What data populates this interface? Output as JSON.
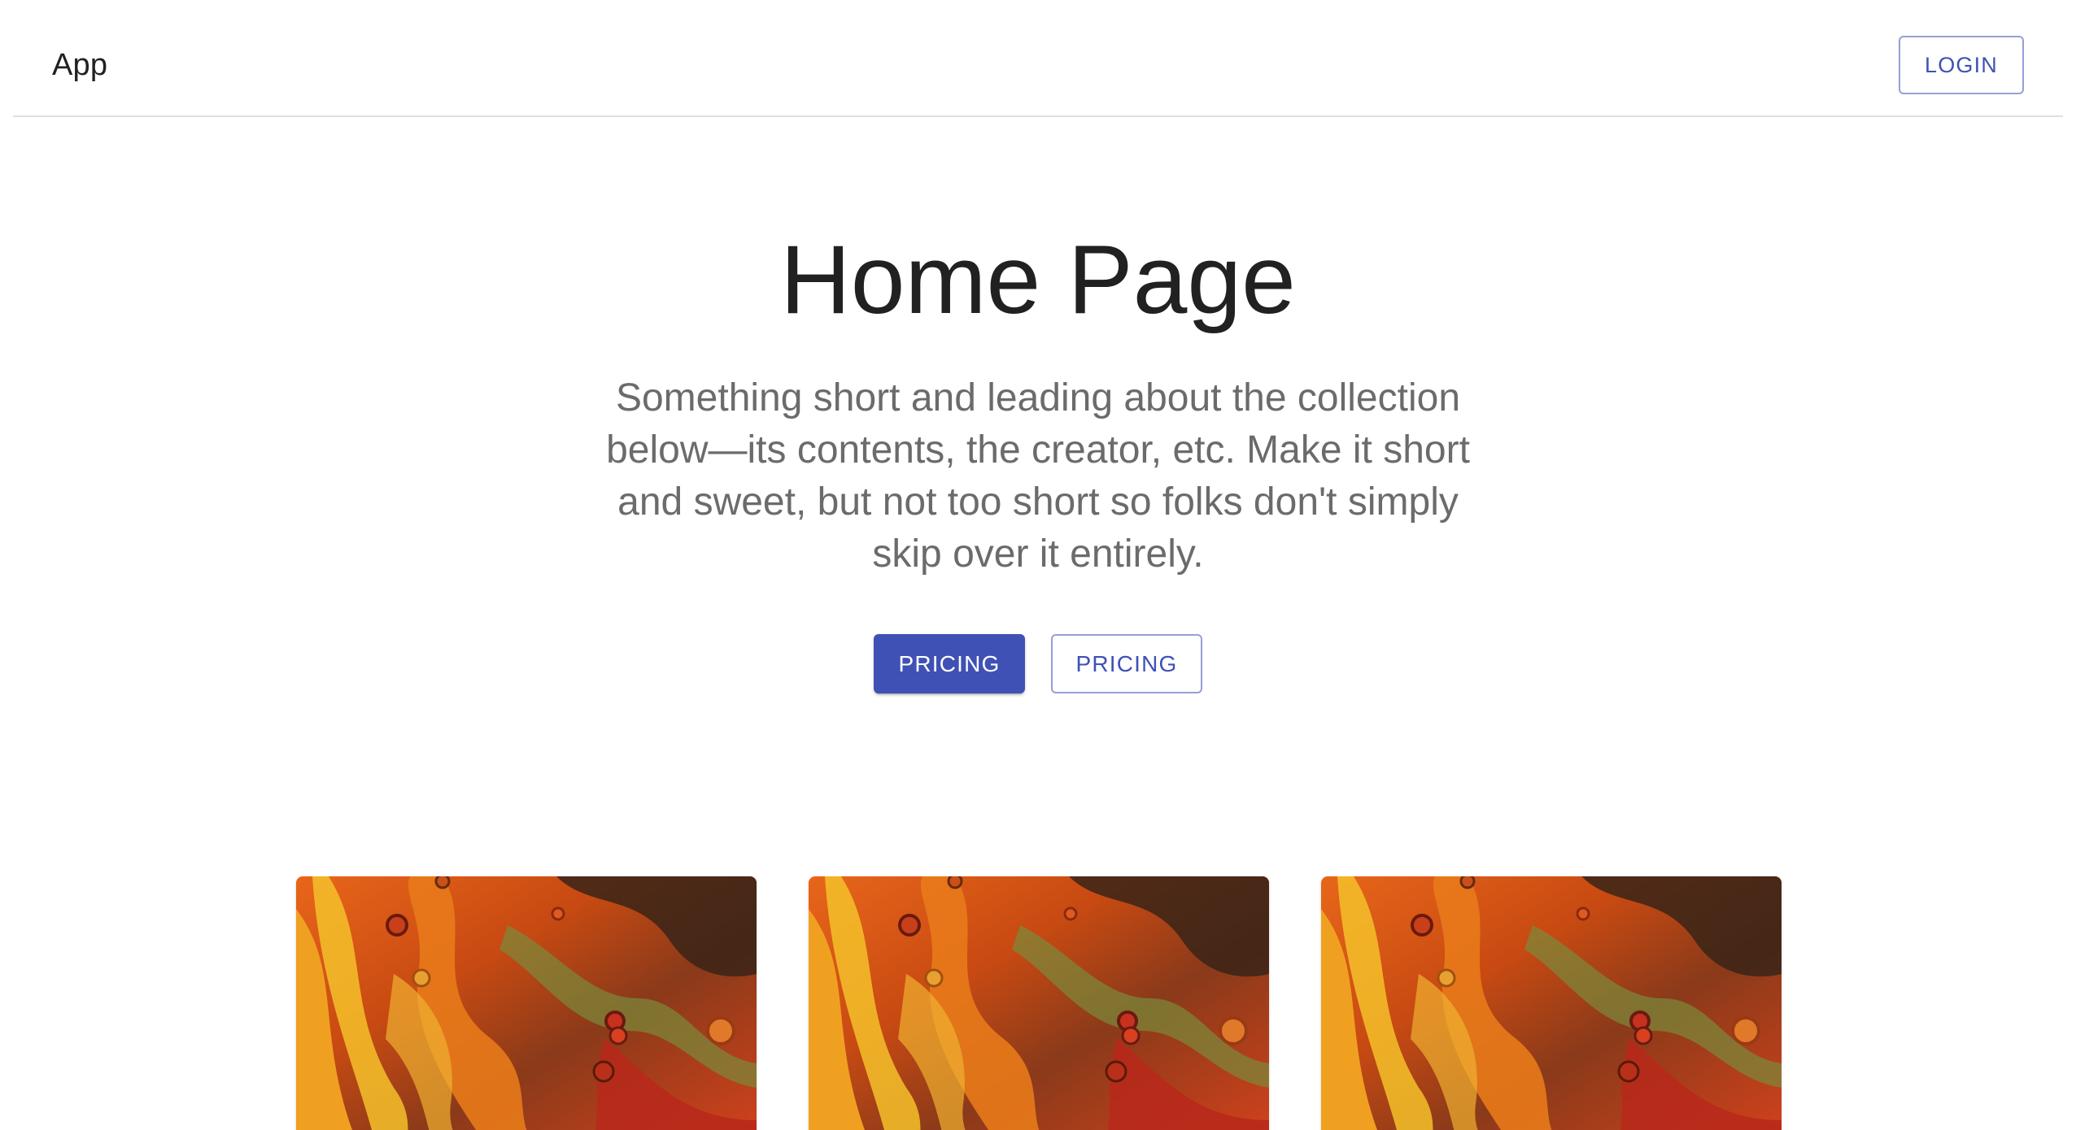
{
  "header": {
    "app_title": "App",
    "login_label": "LOGIN"
  },
  "hero": {
    "title": "Home Page",
    "subtitle": "Something short and leading about the collection below—its contents, the creator, etc. Make it short and sweet, but not too short so folks don't simply skip over it entirely.",
    "primary_button_label": "PRICING",
    "secondary_button_label": "PRICING"
  },
  "cards": [
    {
      "image": "abstract-fluid-orange-painting"
    },
    {
      "image": "abstract-fluid-orange-painting"
    },
    {
      "image": "abstract-fluid-orange-painting"
    }
  ],
  "colors": {
    "primary": "#3f51b5",
    "text": "#212121",
    "subtext": "#6b6b6b",
    "divider": "#e0e0e0"
  }
}
